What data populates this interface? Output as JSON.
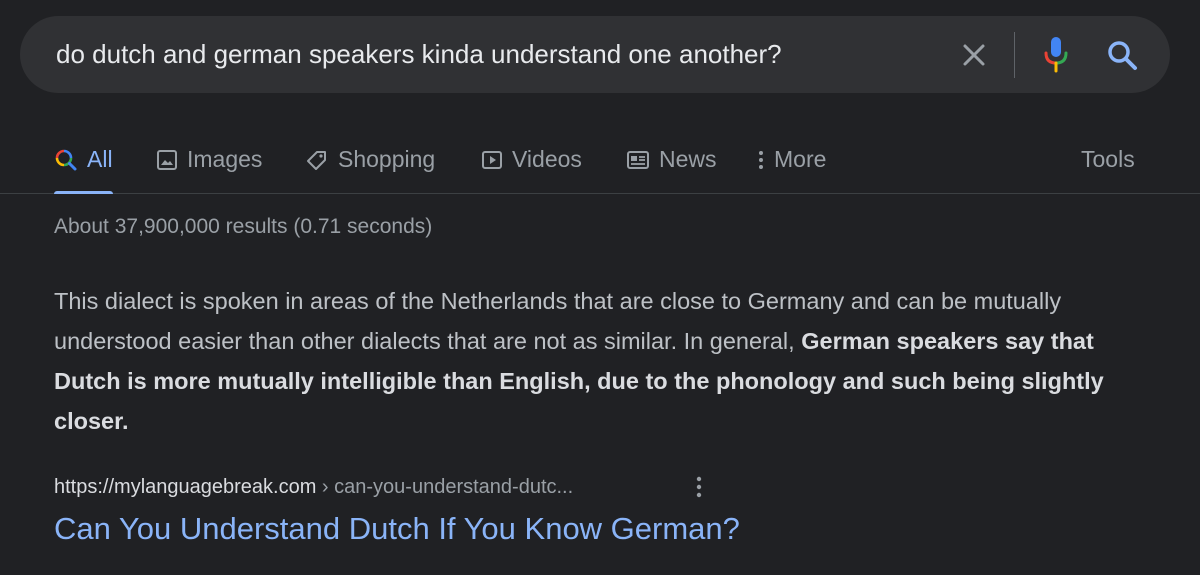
{
  "search": {
    "query": "do dutch and german speakers kinda understand one another?"
  },
  "icons": {
    "clear": "close-icon",
    "voice": "microphone-icon",
    "search": "search-icon",
    "more": "vertical-dots-icon"
  },
  "tabs": [
    {
      "label": "All",
      "icon": "search-icon",
      "active": true
    },
    {
      "label": "Images",
      "icon": "image-icon"
    },
    {
      "label": "Shopping",
      "icon": "tag-icon"
    },
    {
      "label": "Videos",
      "icon": "play-icon"
    },
    {
      "label": "News",
      "icon": "newspaper-icon"
    },
    {
      "label": "More",
      "icon": "vertical-dots-icon"
    },
    {
      "label": "Tools"
    }
  ],
  "stats": {
    "text": "About 37,900,000 results (0.71 seconds)"
  },
  "snippet": {
    "plain": "This dialect is spoken in areas of the Netherlands that are close to Germany and can be mutually understood easier than other dialects that are not as similar. In general, ",
    "bold": "German speakers say that Dutch is more mutually intelligible than English, due to the phonology and such being slightly closer."
  },
  "result": {
    "site": "https://mylanguagebreak.com",
    "breadcrumb": " › can-you-understand-dutc...",
    "title": "Can You Understand Dutch If You Know German?"
  },
  "colors": {
    "background": "#202124",
    "searchbar": "#303134",
    "link": "#8ab4f8",
    "text": "#bdc1c6",
    "muted": "#9aa0a6"
  }
}
